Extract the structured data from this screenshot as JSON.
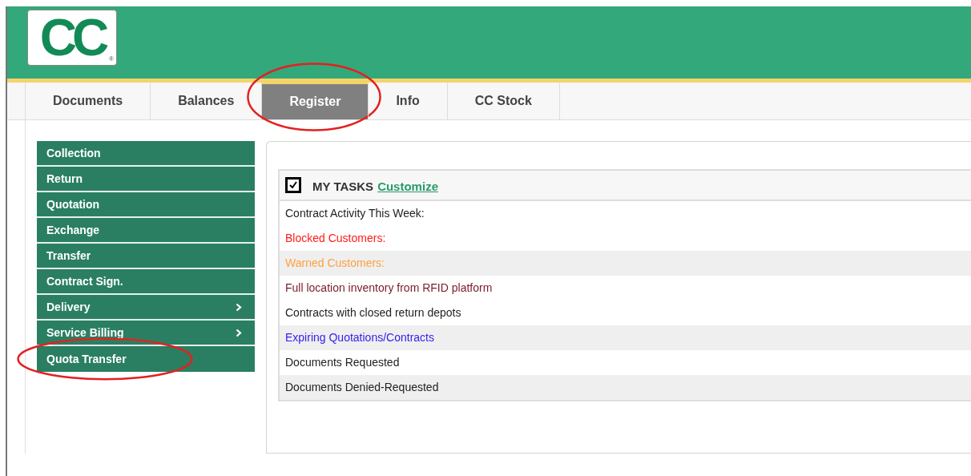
{
  "logo": {
    "text": "CC",
    "mark": "®"
  },
  "tabs": [
    {
      "label": "Documents",
      "selected": false,
      "circled": false
    },
    {
      "label": "Balances",
      "selected": false,
      "circled": false
    },
    {
      "label": "Register",
      "selected": true,
      "circled": true
    },
    {
      "label": "Info",
      "selected": false,
      "circled": false
    },
    {
      "label": "CC Stock",
      "selected": false,
      "circled": false
    }
  ],
  "sidebar": {
    "items": [
      {
        "label": "Collection",
        "submenu": false,
        "circled": false
      },
      {
        "label": "Return",
        "submenu": false,
        "circled": false
      },
      {
        "label": "Quotation",
        "submenu": false,
        "circled": false
      },
      {
        "label": "Exchange",
        "submenu": false,
        "circled": false
      },
      {
        "label": "Transfer",
        "submenu": false,
        "circled": false
      },
      {
        "label": "Contract Sign.",
        "submenu": false,
        "circled": false
      },
      {
        "label": "Delivery",
        "submenu": true,
        "circled": false
      },
      {
        "label": "Service Billing",
        "submenu": true,
        "circled": false
      },
      {
        "label": "Quota Transfer",
        "submenu": false,
        "circled": true
      }
    ]
  },
  "tasks": {
    "checked": true,
    "title": "MY TASKS",
    "link": "Customize",
    "rows": [
      {
        "label": "Contract Activity This Week:",
        "color": "#222222",
        "shaded": false
      },
      {
        "label": "Blocked Customers:",
        "color": "#ff1a1a",
        "shaded": false
      },
      {
        "label": "Warned Customers:",
        "color": "#ffa040",
        "shaded": true
      },
      {
        "label": "Full location inventory from RFID platform",
        "color": "#7a1a2a",
        "shaded": false
      },
      {
        "label": "Contracts with closed return depots",
        "color": "#222222",
        "shaded": false
      },
      {
        "label": "Expiring Quotations/Contracts",
        "color": "#3322ee",
        "shaded": true
      },
      {
        "label": "Documents Requested",
        "color": "#222222",
        "shaded": false
      },
      {
        "label": "Documents Denied-Requested",
        "color": "#222222",
        "shaded": true
      }
    ]
  }
}
